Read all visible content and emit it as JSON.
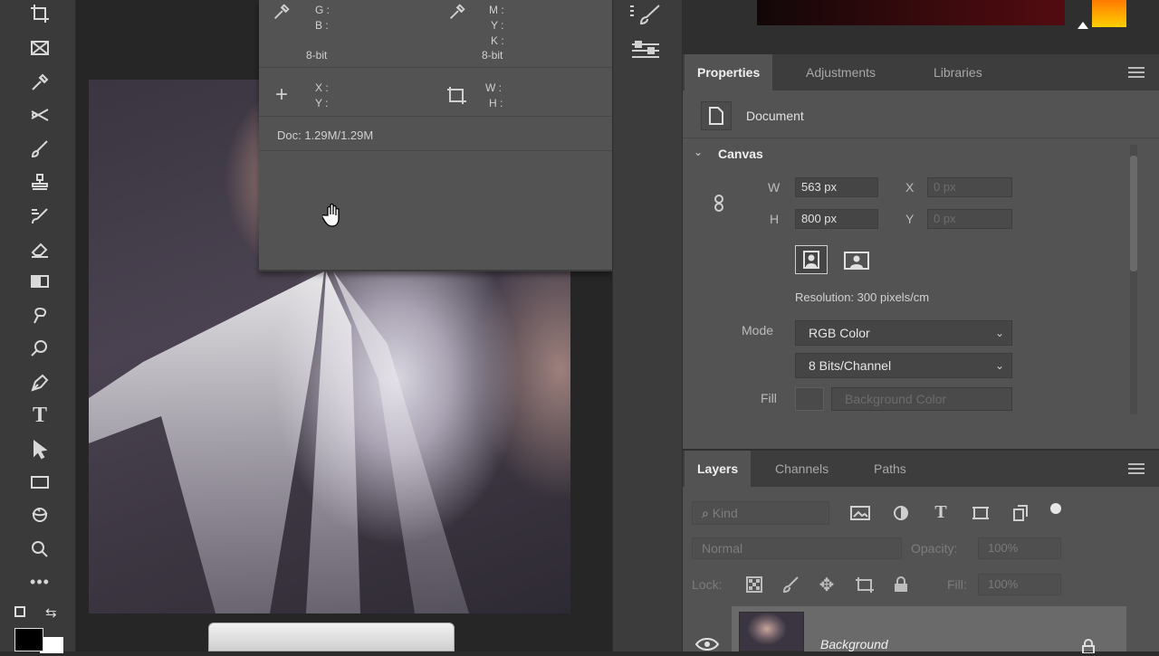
{
  "info_panel": {
    "g_label": "G :",
    "b_label": "B :",
    "bit_left": "8-bit",
    "m_label": "M :",
    "y_label": "Y :",
    "k_label": "K :",
    "bit_right": "8-bit",
    "x_label": "X :",
    "y2_label": "Y :",
    "w_label": "W :",
    "h_label": "H :",
    "doc": "Doc: 1.29M/1.29M"
  },
  "properties": {
    "tabs": [
      "Properties",
      "Adjustments",
      "Libraries"
    ],
    "document_label": "Document",
    "canvas_section": "Canvas",
    "w_label": "W",
    "w_value": "563 px",
    "x_label": "X",
    "x_value": "0 px",
    "h_label": "H",
    "h_value": "800 px",
    "y_label": "Y",
    "y_value": "0 px",
    "resolution": "Resolution: 300 pixels/cm",
    "mode_label": "Mode",
    "mode_value": "RGB Color",
    "bits_value": "8 Bits/Channel",
    "fill_label": "Fill",
    "fill_value": "Background Color"
  },
  "layers": {
    "tabs": [
      "Layers",
      "Channels",
      "Paths"
    ],
    "kind_placeholder": "Kind",
    "blend_mode": "Normal",
    "opacity_label": "Opacity:",
    "opacity_value": "100%",
    "lock_label": "Lock:",
    "fill_label": "Fill:",
    "fill_value": "100%",
    "layer_name": "Background"
  },
  "tools": [
    "crop-icon",
    "frame-icon",
    "eyedropper-icon",
    "healing-icon",
    "brush-icon",
    "stamp-icon",
    "history-brush-icon",
    "eraser-icon",
    "gradient-icon",
    "blur-icon",
    "dodge-icon",
    "pen-icon",
    "type-icon",
    "path-select-icon",
    "rectangle-icon",
    "3d-rotate-icon",
    "zoom-icon",
    "more-tools-icon"
  ],
  "colors": {
    "panel": "#535353",
    "tabbar": "#3d3d3d",
    "foreground": "#000000",
    "background": "#ffffff"
  }
}
